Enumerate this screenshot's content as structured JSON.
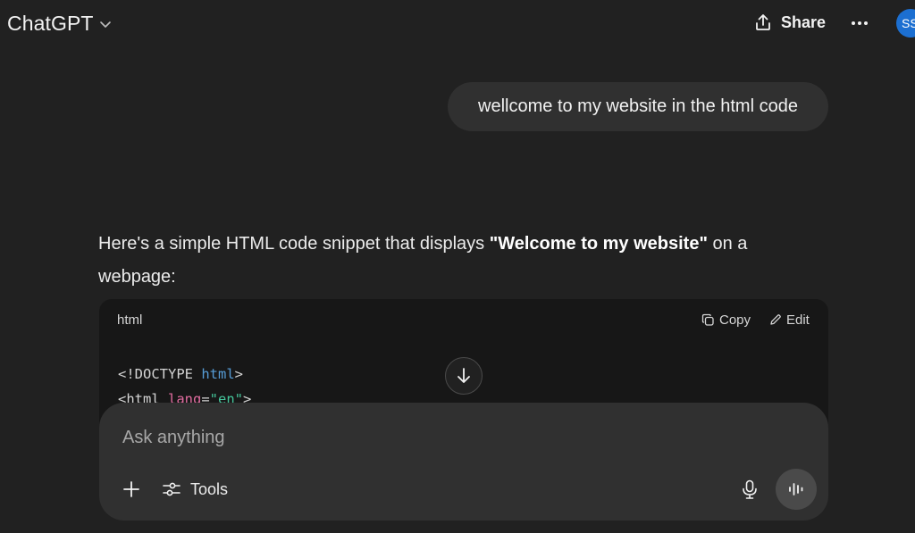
{
  "header": {
    "model_name": "ChatGPT",
    "share_label": "Share",
    "avatar_initials": "SS",
    "icons": [
      "chevron-down-icon",
      "share-upload-icon",
      "more-dots-icon"
    ]
  },
  "conversation": {
    "user_message": "wellcome to my website in the html code",
    "assistant_intro_before": "Here's a simple HTML code snippet that displays ",
    "assistant_intro_bold": "\"Welcome to my website\"",
    "assistant_intro_after": " on a webpage:",
    "code_block": {
      "language": "html",
      "copy_label": "Copy",
      "edit_label": "Edit",
      "line1": {
        "open": "<!DOCTYPE ",
        "keyword": "html",
        "close": ">"
      },
      "line2": {
        "open": "<html ",
        "attr": "lang",
        "eq": "=",
        "value": "\"en\"",
        "close": ">"
      }
    }
  },
  "composer": {
    "placeholder": "Ask anything",
    "tools_label": "Tools"
  },
  "colors": {
    "background": "#212121",
    "bubble": "#303030",
    "code_background": "#171717",
    "avatar": "#1c6fd1"
  }
}
